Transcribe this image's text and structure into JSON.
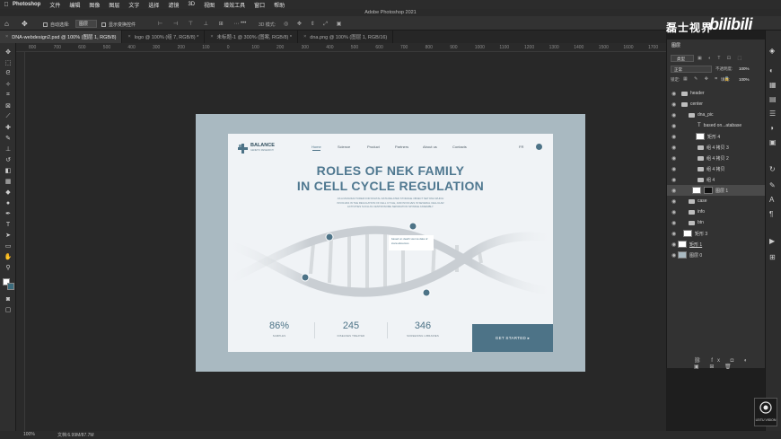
{
  "menubar": {
    "items": [
      "Photoshop",
      "文件",
      "编辑",
      "图像",
      "图层",
      "文字",
      "选择",
      "滤镜",
      "3D",
      "视图",
      "增效工具",
      "窗口",
      "帮助"
    ]
  },
  "window_title": "Adobe Photoshop 2021",
  "options": {
    "auto_select_label": "自动选择:",
    "auto_select_value": "图层",
    "show_transform_label": "显示变换控件",
    "mode_3d": "3D 模式:"
  },
  "tabs": [
    {
      "label": "DNA-webdesign2.psd @ 100% (图层 1, RGB/8)"
    },
    {
      "label": "logo @ 100% (组 7, RGB/8) *"
    },
    {
      "label": "未标题-1 @ 300% (图案, RGB/8) *"
    },
    {
      "label": "dna.png @ 100% (图层 1, RGB/16)"
    }
  ],
  "ruler_ticks": [
    "800",
    "700",
    "600",
    "500",
    "400",
    "300",
    "200",
    "100",
    "0",
    "100",
    "200",
    "300",
    "400",
    "500",
    "600",
    "700",
    "800",
    "900",
    "1000",
    "1100",
    "1200",
    "1300",
    "1400",
    "1500",
    "1600",
    "1700"
  ],
  "design": {
    "brand": "BALANCE",
    "brand_sub": "GENETIC RESEARCH",
    "nav": [
      "Home",
      "Science",
      "Product",
      "Partners",
      "About us",
      "Contacts"
    ],
    "lang": "FR",
    "headline_1": "ROLES OF NEK FAMILY",
    "headline_2": "IN CELL CYCLE REGULATION",
    "body": "AS A MANUFACTURER FOR DIGITAL DATA RELATED STORAGE OBJECT NET DNA WHICH INVOLVES IN THE REGULATION OF CELL CYCLE, AND INVOLVES IN SEVERAL CELLULAR ACTIVITIES SUCH AS CENTROSOME SEPARATION SPINDLE ASSEMBLY.",
    "callout": "based on death vienna data of icara aboutcos",
    "stats": [
      {
        "value": "86%",
        "label": "SAMPLES"
      },
      {
        "value": "245",
        "label": "DISEASES TREATED"
      },
      {
        "value": "346",
        "label": "SCREENING LIBRARIES"
      }
    ],
    "cta": "GET STARTED  ▸"
  },
  "panel": {
    "title": "图层",
    "kind": "类型",
    "blend": "正常",
    "opacity_label": "不透明度:",
    "opacity": "100%",
    "lock_label": "锁定:",
    "fill_label": "填充:",
    "fill": "100%",
    "layers": [
      {
        "name": "header",
        "type": "folder",
        "indent": 0
      },
      {
        "name": "center",
        "type": "folder",
        "indent": 0
      },
      {
        "name": "dna_pic",
        "type": "folder",
        "indent": 1
      },
      {
        "name": "based on...atabase",
        "type": "text",
        "indent": 2
      },
      {
        "name": "矩形 4",
        "type": "shape",
        "indent": 2
      },
      {
        "name": "组 4 拷贝 3",
        "type": "folder",
        "indent": 2
      },
      {
        "name": "组 4 拷贝 2",
        "type": "folder",
        "indent": 2
      },
      {
        "name": "组 4 拷贝",
        "type": "folder",
        "indent": 2
      },
      {
        "name": "组 4",
        "type": "folder",
        "indent": 2
      },
      {
        "name": "图层 1",
        "type": "masked",
        "indent": 2
      },
      {
        "name": "case",
        "type": "folder",
        "indent": 1
      },
      {
        "name": "info",
        "type": "folder",
        "indent": 1
      },
      {
        "name": "btn",
        "type": "folder",
        "indent": 1
      },
      {
        "name": "矩形 3",
        "type": "shape",
        "indent": 0
      },
      {
        "name": "矩形 1",
        "type": "shape",
        "indent": 0
      },
      {
        "name": "图层 0",
        "type": "image",
        "indent": 0
      }
    ]
  },
  "status": {
    "zoom": "100%",
    "doc": "文档:6.99M/87.7M"
  },
  "watermark": {
    "left": "磊士视界",
    "right": "bilibili",
    "logo_text": "LEITU VISION"
  },
  "colors": {
    "accent": "#4d7387",
    "headline": "#4f7890",
    "cta_bg": "#4d7387",
    "artboard": "#a9b9c1"
  }
}
